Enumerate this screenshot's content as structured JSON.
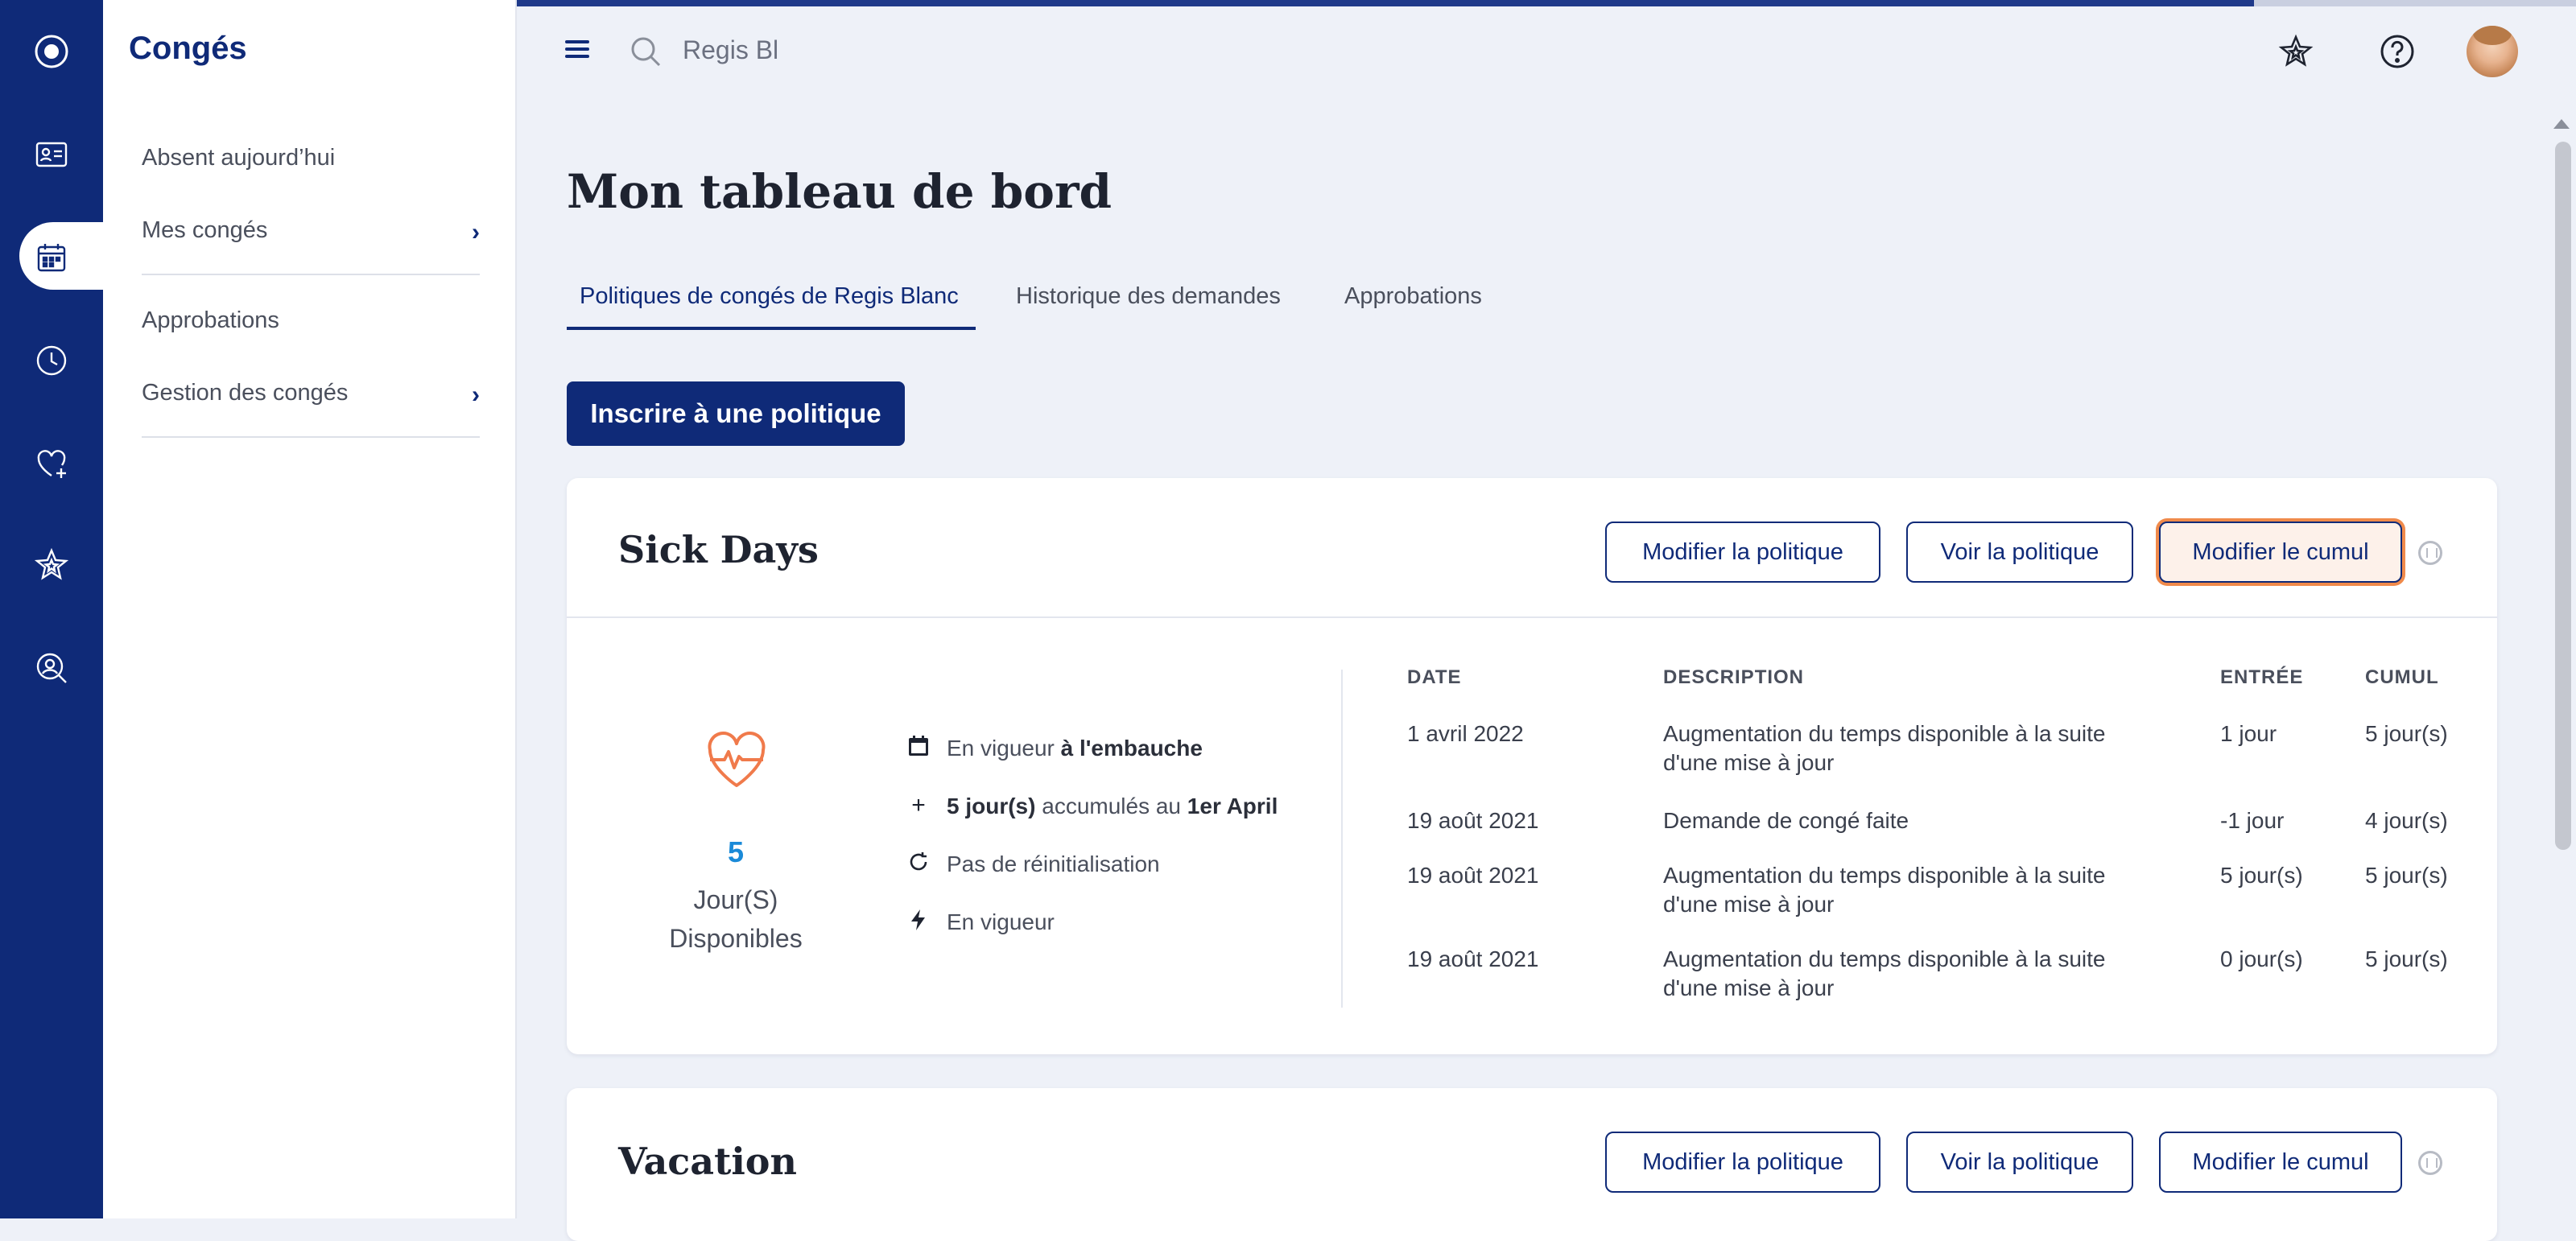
{
  "app": {
    "section_title": "Congés"
  },
  "rail": {
    "items": [
      "logo-icon",
      "id-card-icon",
      "calendar-icon",
      "clock-icon",
      "heart-plus-icon",
      "star-icon",
      "search-person-icon"
    ],
    "active": "calendar-icon"
  },
  "sidebar": {
    "items": [
      {
        "label": "Absent aujourd’hui"
      },
      {
        "label": "Mes congés",
        "chevron": "›"
      },
      {
        "label": "Approbations"
      },
      {
        "label": "Gestion des congés",
        "chevron": "›"
      }
    ]
  },
  "header": {
    "search_value": "Regis Bl"
  },
  "main": {
    "title": "Mon tableau de bord",
    "tabs": [
      {
        "label": "Politiques de congés de Regis Blanc",
        "active": true
      },
      {
        "label": "Historique des demandes"
      },
      {
        "label": "Approbations"
      }
    ],
    "enroll_button": "Inscrire à une politique"
  },
  "policies": [
    {
      "title": "Sick Days",
      "buttons": {
        "edit_policy": "Modifier la politique",
        "view_policy": "Voir la politique",
        "edit_accrual": "Modifier le cumul"
      },
      "available": "5",
      "available_unit": "Jour(S)",
      "available_label": "Disponibles",
      "info": {
        "effective_prefix": "En vigueur ",
        "effective_bold": "à l'embauche",
        "accrual_bold": "5 jour(s)",
        "accrual_mid": " accumulés au ",
        "accrual_date": "1er April",
        "reset": "Pas de réinitialisation",
        "status": "En vigueur"
      },
      "table": {
        "headers": [
          "DATE",
          "DESCRIPTION",
          "ENTRÉE",
          "CUMUL"
        ],
        "rows": [
          {
            "date": "1 avril 2022",
            "desc1": "Augmentation du temps disponible à la suite",
            "desc2": "d'une mise à jour",
            "entry": "1 jour",
            "total": "5 jour(s)"
          },
          {
            "date": "19 août 2021",
            "desc1": "Demande de congé faite",
            "desc2": "",
            "entry": "-1 jour",
            "total": "4 jour(s)"
          },
          {
            "date": "19 août 2021",
            "desc1": "Augmentation du temps disponible à la suite",
            "desc2": "d'une mise à jour",
            "entry": "5 jour(s)",
            "total": "5 jour(s)"
          },
          {
            "date": "19 août 2021",
            "desc1": "Augmentation du temps disponible à la suite",
            "desc2": "d'une mise à jour",
            "entry": "0 jour(s)",
            "total": "5 jour(s)"
          }
        ]
      }
    },
    {
      "title": "Vacation",
      "buttons": {
        "edit_policy": "Modifier la politique",
        "view_policy": "Voir la politique",
        "edit_accrual": "Modifier le cumul"
      }
    }
  ],
  "colors": {
    "brand": "#0f2a78",
    "accent_focus": "#f08a4b",
    "heart_icon": "#f07a4b",
    "available_number": "#1a8ad8"
  }
}
